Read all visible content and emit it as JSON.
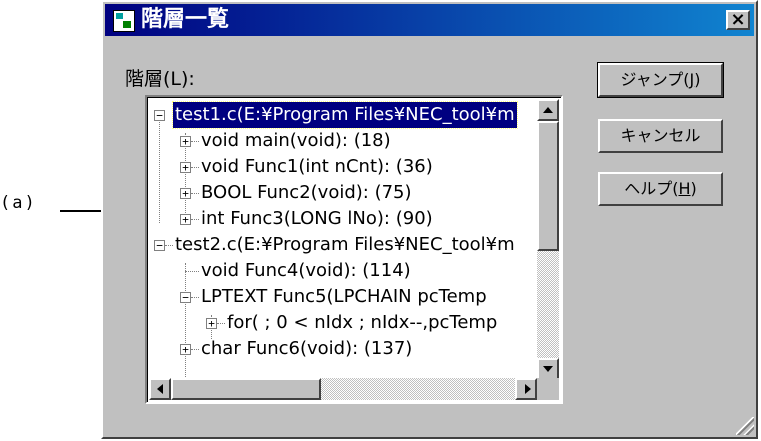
{
  "callout": {
    "label": "(a)"
  },
  "dialog": {
    "title": "階層一覧",
    "close_label": "×",
    "tree_label": "階層(L):"
  },
  "tree": {
    "items": [
      {
        "label": "test1.c(E:¥Program Files¥NEC_tool¥m",
        "expander": "−",
        "selected": true
      },
      {
        "label": "void main(void): (18)",
        "expander": "+"
      },
      {
        "label": "void Func1(int nCnt): (36)",
        "expander": "+"
      },
      {
        "label": "BOOL Func2(void): (75)",
        "expander": "+"
      },
      {
        "label": "int Func3(LONG lNo): (90)",
        "expander": "+"
      },
      {
        "label": "test2.c(E:¥Program Files¥NEC_tool¥m",
        "expander": "−"
      },
      {
        "label": "void Func4(void): (114)",
        "expander": ""
      },
      {
        "label": "LPTEXT Func5(LPCHAIN pcTemp",
        "expander": "−"
      },
      {
        "label": "for( ; 0 < nIdx ; nIdx--,pcTemp",
        "expander": "+"
      },
      {
        "label": "char Func6(void): (137)",
        "expander": "+"
      }
    ]
  },
  "buttons": {
    "jump": {
      "label": "ジャンプ(",
      "mnemonic": "J",
      "suffix": ")"
    },
    "cancel": {
      "label": "キャンセル"
    },
    "help": {
      "label": "ヘルプ(",
      "mnemonic": "H",
      "suffix": ")"
    }
  }
}
